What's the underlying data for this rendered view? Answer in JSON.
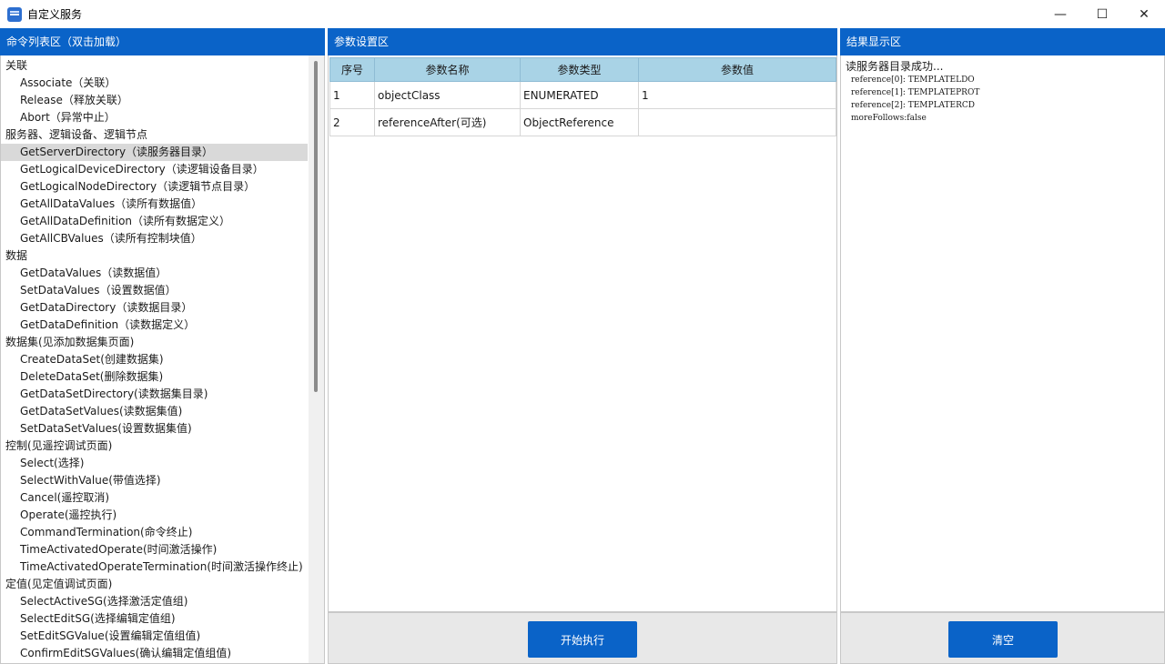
{
  "window": {
    "title": "自定义服务",
    "controls": [
      "—",
      "☐",
      "✕"
    ]
  },
  "panels": {
    "commands_header": "命令列表区（双击加载）",
    "params_header": "参数设置区",
    "results_header": "结果显示区"
  },
  "commands": [
    {
      "type": "group",
      "label": "关联"
    },
    {
      "type": "cmd",
      "label": "Associate（关联）"
    },
    {
      "type": "cmd",
      "label": "Release（释放关联）"
    },
    {
      "type": "cmd",
      "label": "Abort（异常中止）"
    },
    {
      "type": "group",
      "label": "服务器、逻辑设备、逻辑节点"
    },
    {
      "type": "cmd",
      "label": "GetServerDirectory（读服务器目录）",
      "selected": true
    },
    {
      "type": "cmd",
      "label": "GetLogicalDeviceDirectory（读逻辑设备目录）"
    },
    {
      "type": "cmd",
      "label": "GetLogicalNodeDirectory（读逻辑节点目录）"
    },
    {
      "type": "cmd",
      "label": "GetAllDataValues（读所有数据值）"
    },
    {
      "type": "cmd",
      "label": "GetAllDataDefinition（读所有数据定义）"
    },
    {
      "type": "cmd",
      "label": "GetAllCBValues（读所有控制块值）"
    },
    {
      "type": "group",
      "label": "数据"
    },
    {
      "type": "cmd",
      "label": "GetDataValues（读数据值）"
    },
    {
      "type": "cmd",
      "label": "SetDataValues（设置数据值）"
    },
    {
      "type": "cmd",
      "label": "GetDataDirectory（读数据目录）"
    },
    {
      "type": "cmd",
      "label": "GetDataDefinition（读数据定义）"
    },
    {
      "type": "group",
      "label": "数据集(见添加数据集页面)"
    },
    {
      "type": "cmd",
      "label": "CreateDataSet(创建数据集)"
    },
    {
      "type": "cmd",
      "label": "DeleteDataSet(删除数据集)"
    },
    {
      "type": "cmd",
      "label": "GetDataSetDirectory(读数据集目录)"
    },
    {
      "type": "cmd",
      "label": "GetDataSetValues(读数据集值)"
    },
    {
      "type": "cmd",
      "label": "SetDataSetValues(设置数据集值)"
    },
    {
      "type": "group",
      "label": "控制(见遥控调试页面)"
    },
    {
      "type": "cmd",
      "label": "Select(选择)"
    },
    {
      "type": "cmd",
      "label": "SelectWithValue(带值选择)"
    },
    {
      "type": "cmd",
      "label": "Cancel(遥控取消)"
    },
    {
      "type": "cmd",
      "label": "Operate(遥控执行)"
    },
    {
      "type": "cmd",
      "label": "CommandTermination(命令终止)"
    },
    {
      "type": "cmd",
      "label": "TimeActivatedOperate(时间激活操作)"
    },
    {
      "type": "cmd",
      "label": "TimeActivatedOperateTermination(时间激活操作终止)"
    },
    {
      "type": "group",
      "label": "定值(见定值调试页面)"
    },
    {
      "type": "cmd",
      "label": "SelectActiveSG(选择激活定值组)"
    },
    {
      "type": "cmd",
      "label": "SelectEditSG(选择编辑定值组)"
    },
    {
      "type": "cmd",
      "label": "SetEditSGValue(设置编辑定值组值)"
    },
    {
      "type": "cmd",
      "label": "ConfirmEditSGValues(确认编辑定值组值)"
    }
  ],
  "params_table": {
    "headers": [
      "序号",
      "参数名称",
      "参数类型",
      "参数值"
    ],
    "rows": [
      [
        "1",
        "objectClass",
        "ENUMERATED",
        "1"
      ],
      [
        "2",
        "referenceAfter(可选)",
        "ObjectReference",
        ""
      ]
    ]
  },
  "buttons": {
    "execute": "开始执行",
    "clear": "清空"
  },
  "results": {
    "title": "读服务器目录成功...",
    "lines": [
      "reference[0]: TEMPLATELDO",
      "reference[1]: TEMPLATEPROT",
      "reference[2]: TEMPLATERCD",
      "",
      "moreFollows:false"
    ]
  }
}
